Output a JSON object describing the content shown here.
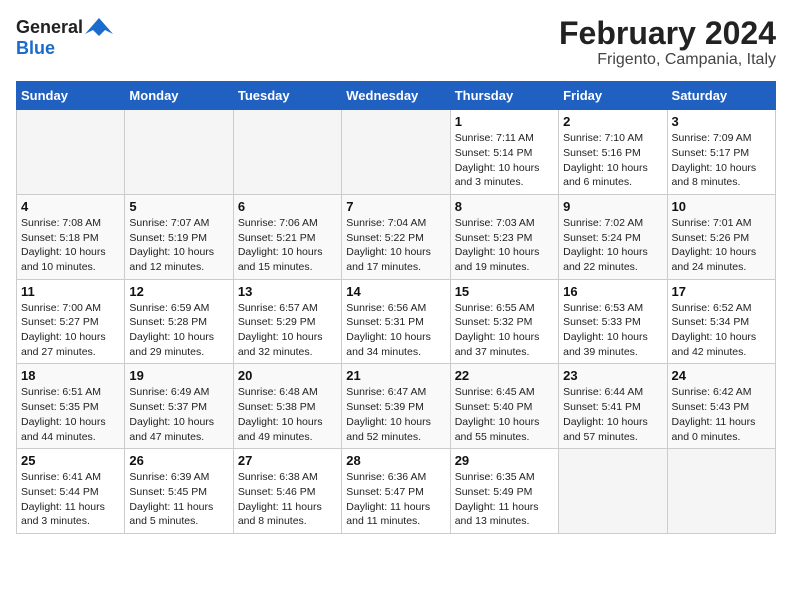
{
  "header": {
    "logo_general": "General",
    "logo_blue": "Blue",
    "title": "February 2024",
    "subtitle": "Frigento, Campania, Italy"
  },
  "calendar": {
    "days_of_week": [
      "Sunday",
      "Monday",
      "Tuesday",
      "Wednesday",
      "Thursday",
      "Friday",
      "Saturday"
    ],
    "weeks": [
      [
        {
          "day": "",
          "info": ""
        },
        {
          "day": "",
          "info": ""
        },
        {
          "day": "",
          "info": ""
        },
        {
          "day": "",
          "info": ""
        },
        {
          "day": "1",
          "info": "Sunrise: 7:11 AM\nSunset: 5:14 PM\nDaylight: 10 hours\nand 3 minutes."
        },
        {
          "day": "2",
          "info": "Sunrise: 7:10 AM\nSunset: 5:16 PM\nDaylight: 10 hours\nand 6 minutes."
        },
        {
          "day": "3",
          "info": "Sunrise: 7:09 AM\nSunset: 5:17 PM\nDaylight: 10 hours\nand 8 minutes."
        }
      ],
      [
        {
          "day": "4",
          "info": "Sunrise: 7:08 AM\nSunset: 5:18 PM\nDaylight: 10 hours\nand 10 minutes."
        },
        {
          "day": "5",
          "info": "Sunrise: 7:07 AM\nSunset: 5:19 PM\nDaylight: 10 hours\nand 12 minutes."
        },
        {
          "day": "6",
          "info": "Sunrise: 7:06 AM\nSunset: 5:21 PM\nDaylight: 10 hours\nand 15 minutes."
        },
        {
          "day": "7",
          "info": "Sunrise: 7:04 AM\nSunset: 5:22 PM\nDaylight: 10 hours\nand 17 minutes."
        },
        {
          "day": "8",
          "info": "Sunrise: 7:03 AM\nSunset: 5:23 PM\nDaylight: 10 hours\nand 19 minutes."
        },
        {
          "day": "9",
          "info": "Sunrise: 7:02 AM\nSunset: 5:24 PM\nDaylight: 10 hours\nand 22 minutes."
        },
        {
          "day": "10",
          "info": "Sunrise: 7:01 AM\nSunset: 5:26 PM\nDaylight: 10 hours\nand 24 minutes."
        }
      ],
      [
        {
          "day": "11",
          "info": "Sunrise: 7:00 AM\nSunset: 5:27 PM\nDaylight: 10 hours\nand 27 minutes."
        },
        {
          "day": "12",
          "info": "Sunrise: 6:59 AM\nSunset: 5:28 PM\nDaylight: 10 hours\nand 29 minutes."
        },
        {
          "day": "13",
          "info": "Sunrise: 6:57 AM\nSunset: 5:29 PM\nDaylight: 10 hours\nand 32 minutes."
        },
        {
          "day": "14",
          "info": "Sunrise: 6:56 AM\nSunset: 5:31 PM\nDaylight: 10 hours\nand 34 minutes."
        },
        {
          "day": "15",
          "info": "Sunrise: 6:55 AM\nSunset: 5:32 PM\nDaylight: 10 hours\nand 37 minutes."
        },
        {
          "day": "16",
          "info": "Sunrise: 6:53 AM\nSunset: 5:33 PM\nDaylight: 10 hours\nand 39 minutes."
        },
        {
          "day": "17",
          "info": "Sunrise: 6:52 AM\nSunset: 5:34 PM\nDaylight: 10 hours\nand 42 minutes."
        }
      ],
      [
        {
          "day": "18",
          "info": "Sunrise: 6:51 AM\nSunset: 5:35 PM\nDaylight: 10 hours\nand 44 minutes."
        },
        {
          "day": "19",
          "info": "Sunrise: 6:49 AM\nSunset: 5:37 PM\nDaylight: 10 hours\nand 47 minutes."
        },
        {
          "day": "20",
          "info": "Sunrise: 6:48 AM\nSunset: 5:38 PM\nDaylight: 10 hours\nand 49 minutes."
        },
        {
          "day": "21",
          "info": "Sunrise: 6:47 AM\nSunset: 5:39 PM\nDaylight: 10 hours\nand 52 minutes."
        },
        {
          "day": "22",
          "info": "Sunrise: 6:45 AM\nSunset: 5:40 PM\nDaylight: 10 hours\nand 55 minutes."
        },
        {
          "day": "23",
          "info": "Sunrise: 6:44 AM\nSunset: 5:41 PM\nDaylight: 10 hours\nand 57 minutes."
        },
        {
          "day": "24",
          "info": "Sunrise: 6:42 AM\nSunset: 5:43 PM\nDaylight: 11 hours\nand 0 minutes."
        }
      ],
      [
        {
          "day": "25",
          "info": "Sunrise: 6:41 AM\nSunset: 5:44 PM\nDaylight: 11 hours\nand 3 minutes."
        },
        {
          "day": "26",
          "info": "Sunrise: 6:39 AM\nSunset: 5:45 PM\nDaylight: 11 hours\nand 5 minutes."
        },
        {
          "day": "27",
          "info": "Sunrise: 6:38 AM\nSunset: 5:46 PM\nDaylight: 11 hours\nand 8 minutes."
        },
        {
          "day": "28",
          "info": "Sunrise: 6:36 AM\nSunset: 5:47 PM\nDaylight: 11 hours\nand 11 minutes."
        },
        {
          "day": "29",
          "info": "Sunrise: 6:35 AM\nSunset: 5:49 PM\nDaylight: 11 hours\nand 13 minutes."
        },
        {
          "day": "",
          "info": ""
        },
        {
          "day": "",
          "info": ""
        }
      ]
    ]
  }
}
